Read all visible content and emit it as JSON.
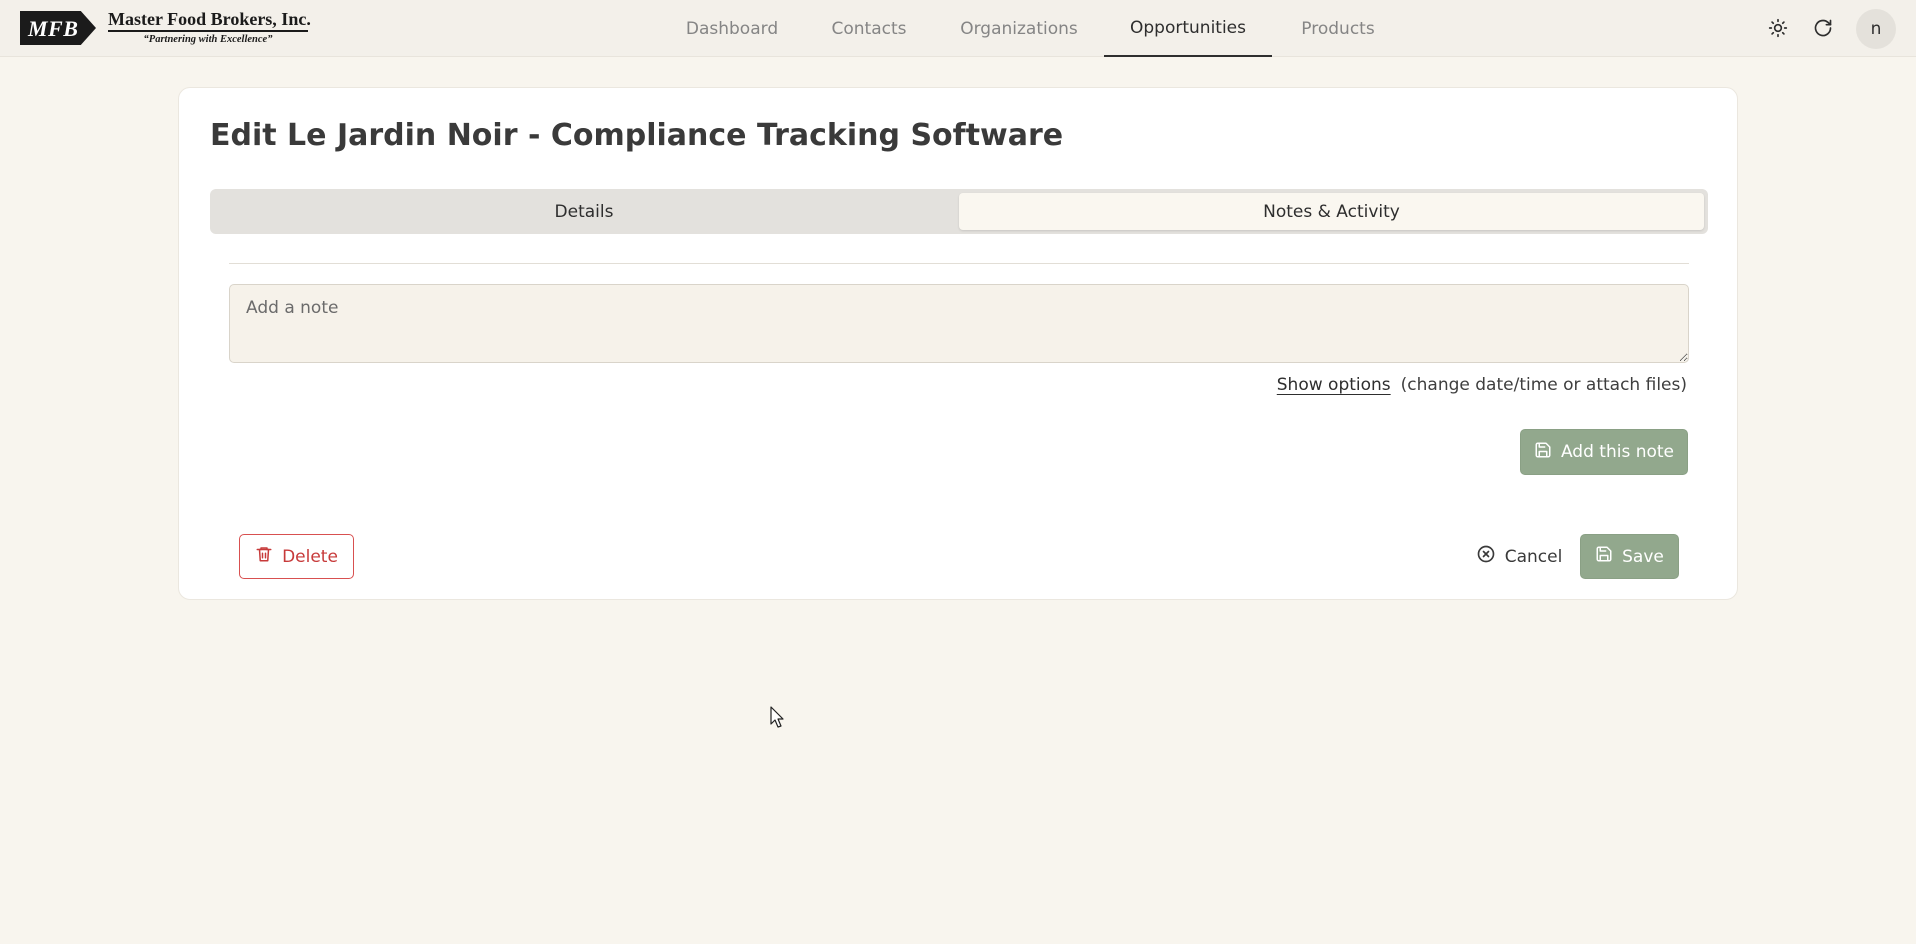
{
  "header": {
    "logo": {
      "mark": "MFB",
      "company": "Master Food Brokers, Inc.",
      "tagline": "“Partnering with Excellence”"
    },
    "nav": [
      {
        "label": "Dashboard",
        "active": false
      },
      {
        "label": "Contacts",
        "active": false
      },
      {
        "label": "Organizations",
        "active": false
      },
      {
        "label": "Opportunities",
        "active": true
      },
      {
        "label": "Products",
        "active": false
      }
    ],
    "icons": {
      "theme": "sun-icon",
      "refresh": "refresh-icon"
    },
    "avatar_initial": "n"
  },
  "page": {
    "title": "Edit Le Jardin Noir - Compliance Tracking Software",
    "tabs": [
      {
        "label": "Details",
        "active": false
      },
      {
        "label": "Notes & Activity",
        "active": true
      }
    ],
    "note": {
      "placeholder": "Add a note",
      "value": "",
      "show_options_label": "Show options",
      "options_hint": "(change date/time or attach files)",
      "add_button_label": "Add this note"
    },
    "actions": {
      "delete_label": "Delete",
      "cancel_label": "Cancel",
      "save_label": "Save"
    }
  },
  "colors": {
    "background": "#f8f5ee",
    "header_bg": "#f3f0ea",
    "primary_button": "#92a88d",
    "danger": "#c73a3a"
  }
}
